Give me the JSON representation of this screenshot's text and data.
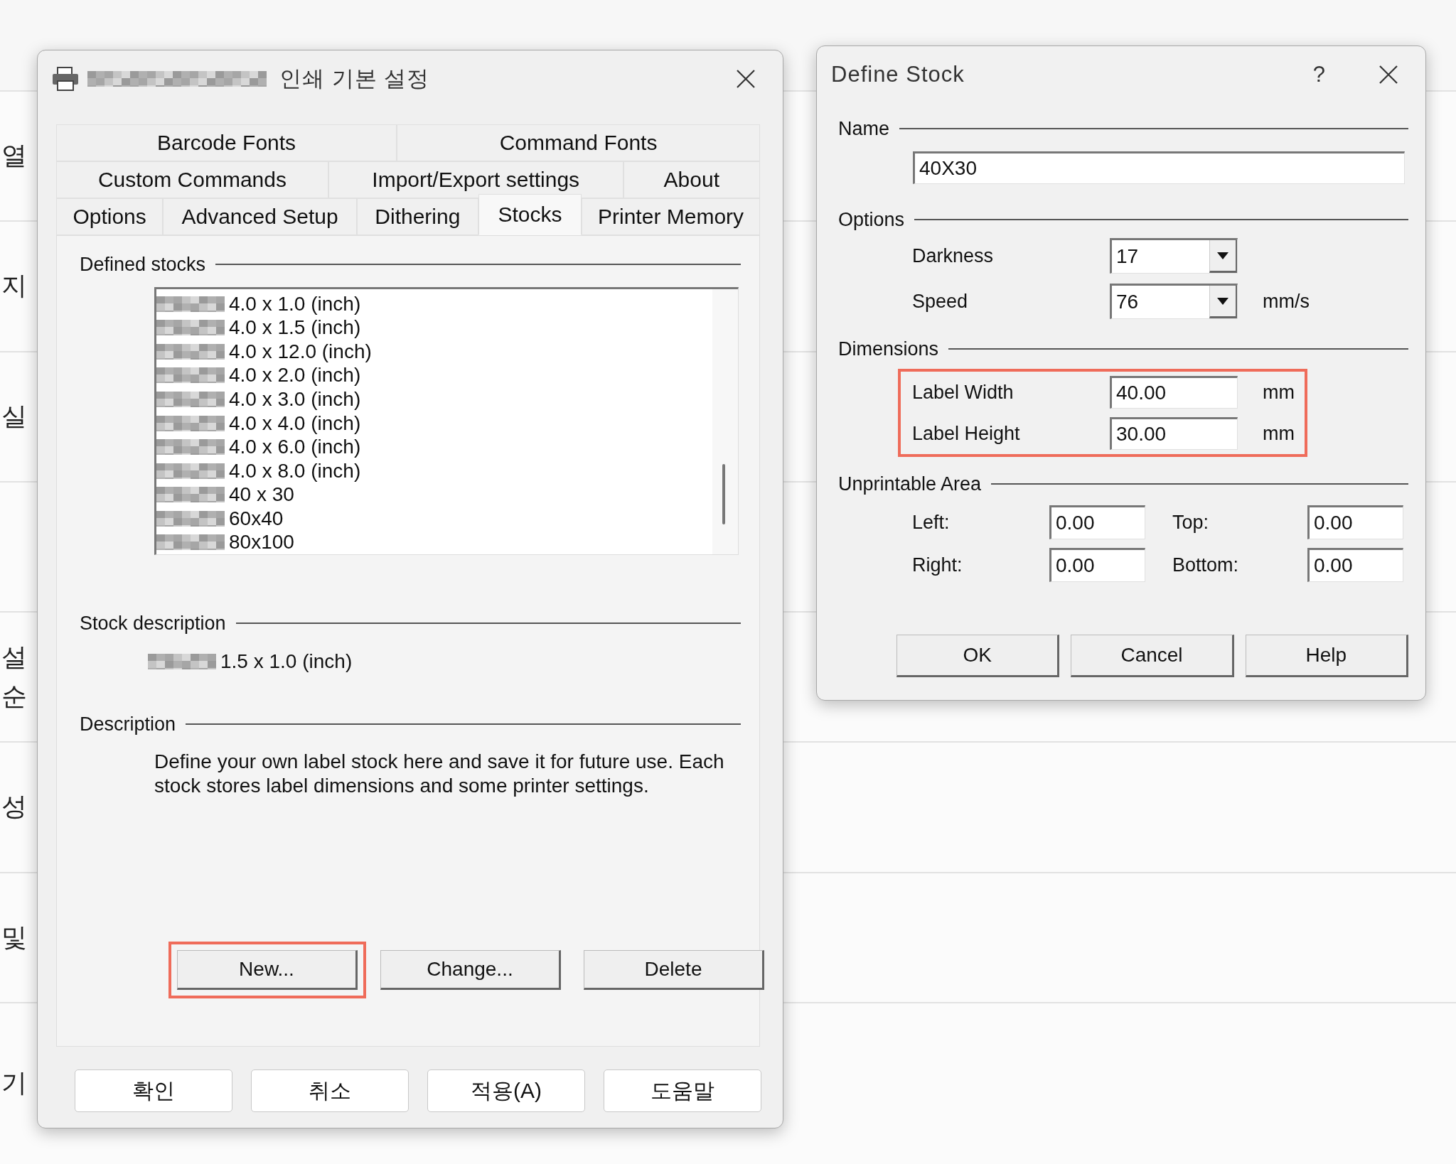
{
  "background": {
    "rows": [
      {
        "texts": [
          "열"
        ]
      },
      {
        "texts": [
          "지"
        ]
      },
      {
        "texts": [
          "실"
        ]
      },
      {
        "texts": []
      },
      {
        "texts": [
          "설",
          "순"
        ]
      },
      {
        "texts": [
          "성"
        ]
      },
      {
        "texts": [
          "및"
        ]
      },
      {
        "texts": [
          "기"
        ]
      }
    ]
  },
  "print_dialog": {
    "title": "인쇄 기본 설정",
    "tab_rows": [
      [
        {
          "label": "Barcode Fonts",
          "selected": false
        },
        {
          "label": "Command Fonts",
          "selected": false
        }
      ],
      [
        {
          "label": "Custom Commands",
          "selected": false
        },
        {
          "label": "Import/Export settings",
          "selected": false
        },
        {
          "label": "About",
          "selected": false
        }
      ],
      [
        {
          "label": "Options",
          "selected": false
        },
        {
          "label": "Advanced Setup",
          "selected": false
        },
        {
          "label": "Dithering",
          "selected": false
        },
        {
          "label": "Stocks",
          "selected": true
        },
        {
          "label": "Printer Memory",
          "selected": false
        }
      ]
    ],
    "defined_stocks": {
      "label": "Defined stocks",
      "items": [
        "4.0 x 1.0 (inch)",
        "4.0 x 1.5 (inch)",
        "4.0 x 12.0 (inch)",
        "4.0 x 2.0 (inch)",
        "4.0 x 3.0 (inch)",
        "4.0 x 4.0 (inch)",
        "4.0 x 6.0 (inch)",
        "4.0 x 8.0 (inch)",
        "40 x 30",
        "60x40",
        "80x100"
      ]
    },
    "stock_description": {
      "label": "Stock description",
      "value": "1.5 x 1.0 (inch)"
    },
    "description": {
      "label": "Description",
      "text": "Define your own label stock here and save it for future use. Each stock stores label dimensions and some printer settings."
    },
    "stock_buttons": [
      {
        "label": "New...",
        "highlighted": true
      },
      {
        "label": "Change...",
        "highlighted": false
      },
      {
        "label": "Delete",
        "highlighted": false
      }
    ],
    "buttons": [
      "확인",
      "취소",
      "적용(A)",
      "도움말"
    ]
  },
  "define_stock": {
    "title": "Define Stock",
    "help": "?",
    "name": {
      "label": "Name",
      "value": "40X30"
    },
    "options": {
      "label": "Options",
      "rows": [
        {
          "label": "Darkness",
          "value": "17"
        },
        {
          "label": "Speed",
          "value": "76",
          "unit": "mm/s"
        }
      ]
    },
    "dimensions": {
      "label": "Dimensions",
      "highlighted": true,
      "rows": [
        {
          "label": "Label Width",
          "value": "40.00",
          "unit": "mm"
        },
        {
          "label": "Label Height",
          "value": "30.00",
          "unit": "mm"
        }
      ]
    },
    "unprintable_area": {
      "label": "Unprintable Area",
      "fields": [
        {
          "label": "Left:",
          "value": "0.00"
        },
        {
          "label": "Top:",
          "value": "0.00"
        },
        {
          "label": "Right:",
          "value": "0.00"
        },
        {
          "label": "Bottom:",
          "value": "0.00"
        }
      ]
    },
    "buttons": [
      "OK",
      "Cancel",
      "Help"
    ]
  }
}
